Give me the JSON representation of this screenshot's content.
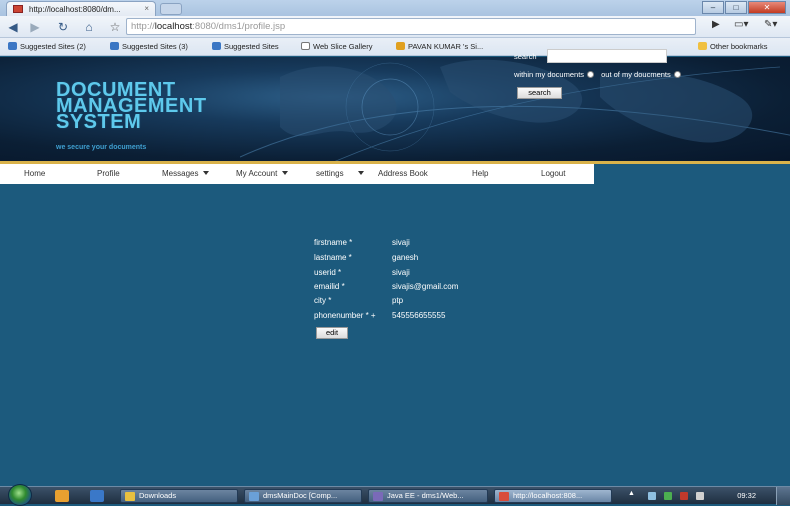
{
  "browser": {
    "tab_title": "http://localhost:8080/dm...",
    "url_scheme": "http://",
    "url_host": "localhost",
    "url_path": ":8080/dms1/profile.jsp",
    "bookmarks": [
      "Suggested Sites (2)",
      "Suggested Sites (3)",
      "Suggested Sites",
      "Web Slice Gallery",
      "PAVAN KUMAR 's Si..."
    ],
    "other_bookmarks": "Other bookmarks"
  },
  "header": {
    "logo_lines": [
      "DOCUMENT",
      "MANAGEMENT",
      "SYSTEM"
    ],
    "tagline": "we secure your documents",
    "search_label": "search",
    "within_label": "within my documents",
    "outof_label": "out of my doucments",
    "search_button": "search"
  },
  "menu": {
    "items": [
      "Home",
      "Profile",
      "Messages",
      "My Account",
      "settings",
      "Address Book",
      "Help",
      "Logout"
    ]
  },
  "profile": {
    "rows": [
      {
        "label": "firstname *",
        "value": "sivaji"
      },
      {
        "label": "lastname *",
        "value": "ganesh"
      },
      {
        "label": "userid *",
        "value": "sivaji"
      },
      {
        "label": "emailid *",
        "value": "sivajis@gmail.com"
      },
      {
        "label": "city *",
        "value": "ptp"
      },
      {
        "label": "phonenumber * +",
        "value": "545556655555"
      }
    ],
    "edit_button": "edit"
  },
  "taskbar": {
    "tasks": [
      "Downloads",
      "dmsMainDoc [Comp...",
      "Java EE - dms1/Web...",
      "http://localhost:808..."
    ],
    "clock": "09:32"
  },
  "colors": {
    "page_bg": "#1c5a7d",
    "logo": "#5ec9ec",
    "accent_line": "#d9b24a"
  }
}
